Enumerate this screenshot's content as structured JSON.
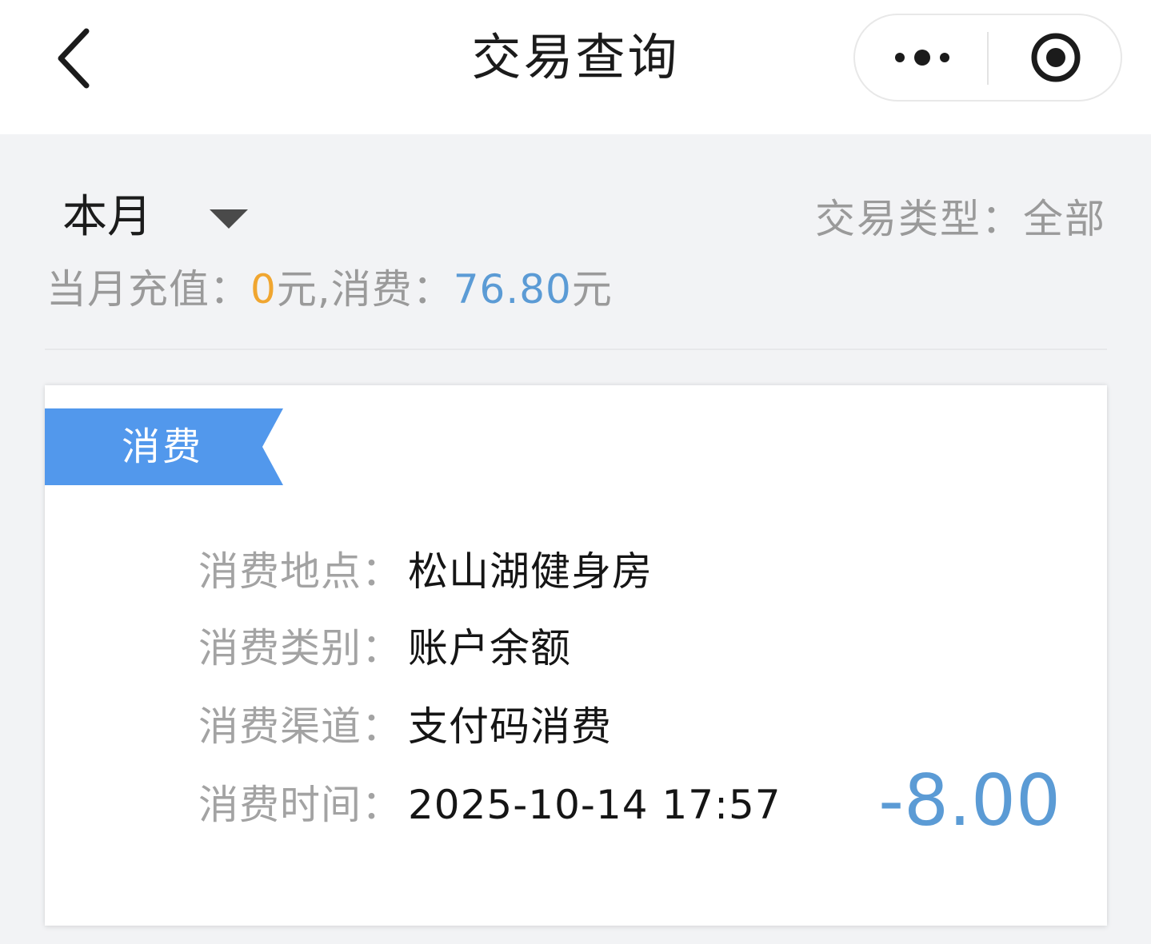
{
  "nav": {
    "title": "交易查询",
    "back_icon": "chevron-left-icon",
    "more_icon": "more-dots-icon",
    "close_icon": "target-circle-icon"
  },
  "filter": {
    "period": "本月",
    "type_label": "交易类型：",
    "type_value": "全部"
  },
  "summary": {
    "recharge_label": "当月充值：",
    "recharge_amount": "0",
    "recharge_unit": "元,",
    "spend_label": "消费：",
    "spend_amount": "76.80",
    "spend_unit": "元"
  },
  "records": [
    {
      "type": "消费",
      "location_label": "消费地点：",
      "location": "松山湖健身房",
      "category_label": "消费类别：",
      "category": "账户余额",
      "channel_label": "消费渠道：",
      "channel": "支付码消费",
      "time_label": "消费时间：",
      "time": "2025-10-14 17:57",
      "amount": "-8.00"
    }
  ],
  "colors": {
    "accent_blue": "#5b9bd5",
    "ribbon_blue": "#5298ec",
    "recharge_orange": "#f0a630",
    "page_background": "#f2f3f5"
  }
}
